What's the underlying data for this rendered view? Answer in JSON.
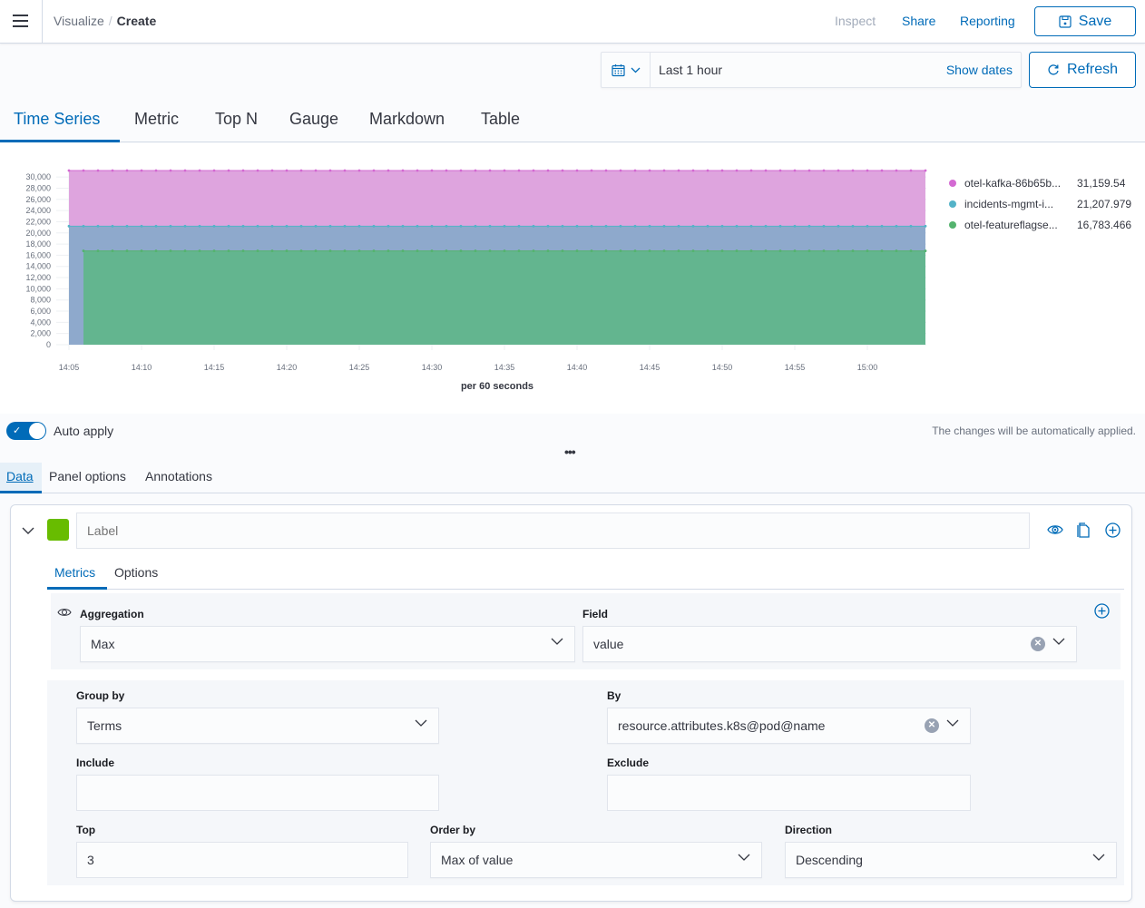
{
  "header": {
    "breadcrumbs": [
      "Visualize",
      "Create"
    ],
    "breadcrumb_separator": "/",
    "links": {
      "inspect": "Inspect",
      "share": "Share",
      "reporting": "Reporting"
    },
    "save_label": "Save"
  },
  "timepicker": {
    "range": "Last 1 hour",
    "show_dates": "Show dates",
    "refresh_label": "Refresh"
  },
  "vis_tabs": [
    "Time Series",
    "Metric",
    "Top N",
    "Gauge",
    "Markdown",
    "Table"
  ],
  "active_vis_tab": "Time Series",
  "chart_data": {
    "type": "area",
    "stacked": true,
    "title": "",
    "xlabel": "per 60 seconds",
    "ylabel": "",
    "ylim": [
      0,
      31159.54
    ],
    "y_ticks": [
      "0",
      "2,000",
      "4,000",
      "6,000",
      "8,000",
      "10,000",
      "12,000",
      "14,000",
      "16,000",
      "18,000",
      "20,000",
      "22,000",
      "24,000",
      "26,000",
      "28,000",
      "30,000"
    ],
    "x_ticks": [
      "14:05",
      "14:10",
      "14:15",
      "14:20",
      "14:25",
      "14:30",
      "14:35",
      "14:40",
      "14:45",
      "14:50",
      "14:55",
      "15:00"
    ],
    "x_range_minutes": [
      "14:05",
      "15:04"
    ],
    "grid": true,
    "legend_position": "right",
    "series": [
      {
        "name": "otel-kafka-86b65b...",
        "color": "#d36ad2",
        "fill": "#dea4de",
        "stack_top": 31159.54,
        "start": "14:05",
        "end": "15:04",
        "legend_value": "31,159.54"
      },
      {
        "name": "incidents-mgmt-i...",
        "color": "#54b3c8",
        "fill": "#8ea9cc",
        "stack_top": 21207.979,
        "start": "14:05",
        "end": "15:04",
        "legend_value": "21,207.979"
      },
      {
        "name": "otel-featureflagse...",
        "color": "#54b36e",
        "fill": "#63b58f",
        "stack_top": 16783.466,
        "start": "14:06",
        "end": "15:04",
        "legend_value": "16,783.466"
      }
    ]
  },
  "auto_apply": {
    "label": "Auto apply",
    "enabled": true,
    "note": "The changes will be automatically applied."
  },
  "resize_handle": "•••",
  "panel_tabs": [
    "Data",
    "Panel options",
    "Annotations"
  ],
  "active_panel_tab": "Data",
  "series_config": {
    "color": "#68bc00",
    "label_placeholder": "Label",
    "label_value": "",
    "inner_tabs": [
      "Metrics",
      "Options"
    ],
    "active_inner_tab": "Metrics",
    "aggregation": {
      "label": "Aggregation",
      "value": "Max"
    },
    "field": {
      "label": "Field",
      "value": "value"
    },
    "group_by": {
      "label": "Group by",
      "value": "Terms"
    },
    "by": {
      "label": "By",
      "value": "resource.attributes.k8s@pod@name"
    },
    "include": {
      "label": "Include",
      "value": ""
    },
    "exclude": {
      "label": "Exclude",
      "value": ""
    },
    "top": {
      "label": "Top",
      "value": "3"
    },
    "order_by": {
      "label": "Order by",
      "value": "Max of value"
    },
    "direction": {
      "label": "Direction",
      "value": "Descending"
    }
  }
}
